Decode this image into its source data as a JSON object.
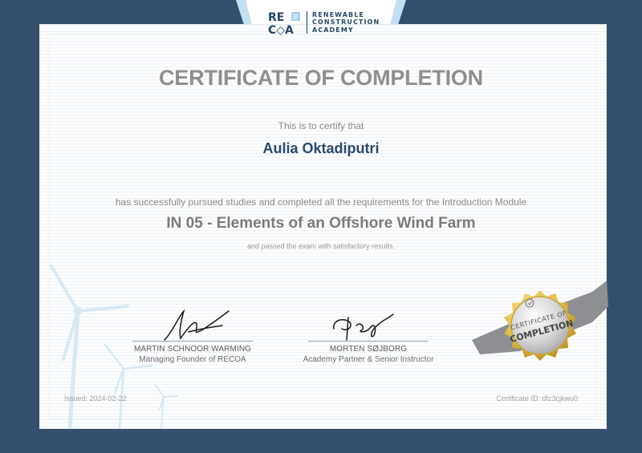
{
  "logo": {
    "mark_top": "RE",
    "mark_bottom": "C◇A",
    "line1": "RENEWABLE",
    "line2": "CONSTRUCTION",
    "line3": "ACADEMY"
  },
  "certificate": {
    "title": "CERTIFICATE OF COMPLETION",
    "intro": "This is to certify that",
    "recipient": "Aulia Oktadiputri",
    "statement": "has successfully pursued studies and completed all the requirements for the Introduction Module",
    "module": "IN 05 - Elements of an Offshore Wind Farm",
    "result": "and passed the exam with satisfactory results."
  },
  "signatories": [
    {
      "name": "MARTIN SCHNOOR WARMING",
      "role": "Managing Founder of RECOA"
    },
    {
      "name": "MORTEN SØJBORG",
      "role": "Academy Partner & Senior Instructor"
    }
  ],
  "seal": {
    "line1": "CERTIFICATE OF",
    "line2": "COMPLETION"
  },
  "footer": {
    "issued": "Issued: 2024-02-22",
    "certificate_id": "Certificate ID: dfz3cjkwu0"
  },
  "colors": {
    "frame": "#364f6e",
    "paper": "#fbfcfd",
    "name_blue": "#294a70",
    "title_grey": "#8f8f8f",
    "seal_gold": "#e8c24a"
  }
}
